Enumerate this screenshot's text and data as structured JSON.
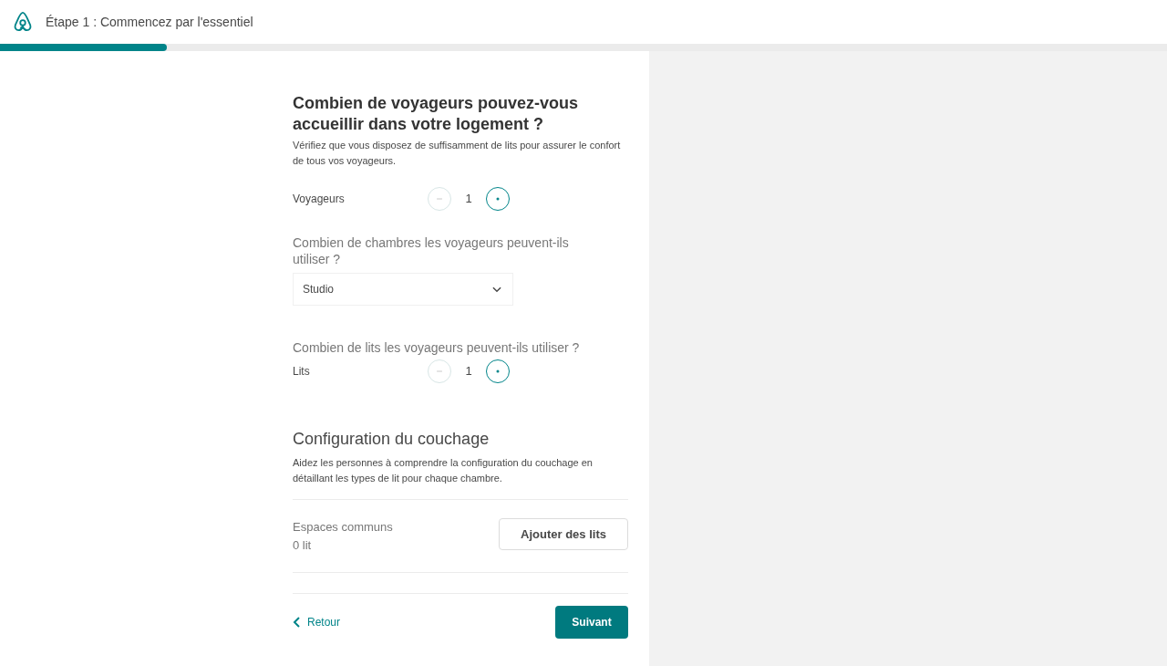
{
  "header": {
    "title": "Étape 1 : Commencez par l'essentiel"
  },
  "progress": {
    "level": 0.143
  },
  "question": {
    "title": "Combien de voyageurs pouvez-vous accueillir dans votre logement ?",
    "hint": "Vérifiez que vous disposez de suffisamment de lits pour assurer le confort de tous vos voyageurs."
  },
  "guests": {
    "label": "Voyageurs",
    "value": "1",
    "minus_disabled": true,
    "plus_disabled": false
  },
  "bedrooms": {
    "question": "Combien de chambres les voyageurs peuvent-ils utiliser ?",
    "value": "Studio"
  },
  "beds": {
    "question": "Combien de lits les voyageurs peuvent-ils utiliser ?",
    "label": "Lits",
    "value": "1",
    "minus_disabled": true,
    "plus_disabled": false
  },
  "sleeping": {
    "title": "Configuration du couchage",
    "hint": "Aidez les personnes à comprendre la configuration du couchage en détaillant les types de lit pour chaque chambre.",
    "rooms": [
      {
        "name": "Espaces communs",
        "count": "0 lit",
        "button": "Ajouter des lits"
      }
    ]
  },
  "footer": {
    "back": "Retour",
    "next": "Suivant"
  }
}
